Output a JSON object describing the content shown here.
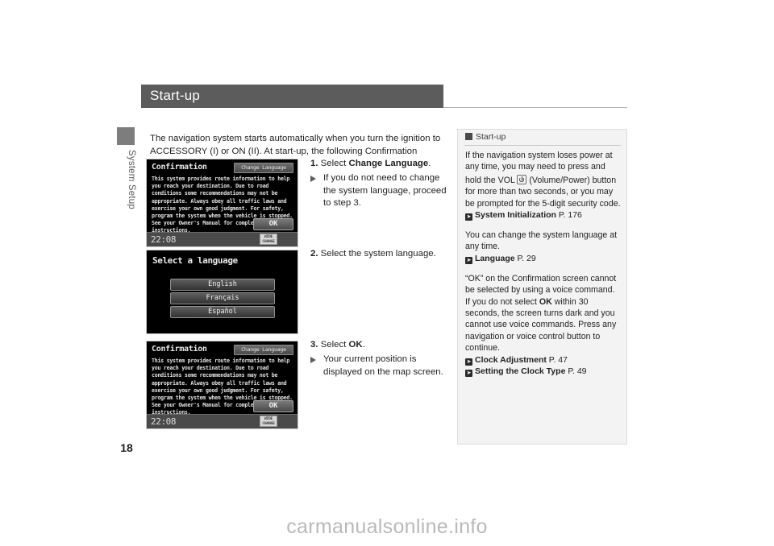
{
  "page": {
    "number": "18",
    "chapter_tab_label": "System Setup",
    "title": "Start-up",
    "watermark": "carmanualsonline.info",
    "accent_color": "#5c5c5c",
    "note_bg_color": "#f3f3f3",
    "chapter_tab_color": "#7d7d7d"
  },
  "intro": {
    "text": "The navigation system starts automatically when you turn the ignition to ACCESSORY (I) or ON (II). At start-up, the following Confirmation screen is displayed."
  },
  "steps": [
    {
      "number": "1.",
      "lead": "Select ",
      "bold": "Change Language",
      "tail": ".",
      "sub": "If you do not need to change the system language, proceed to step 3."
    },
    {
      "number": "2.",
      "lead": "Select the system language.",
      "bold": "",
      "tail": "",
      "sub": ""
    },
    {
      "number": "3.",
      "lead": "Select ",
      "bold": "OK",
      "tail": ".",
      "sub": "Your current position is displayed on the map screen."
    }
  ],
  "screens": {
    "confirmation": {
      "title": "Confirmation",
      "change_language_label": "Change Language",
      "body": "This system provides route information to help you reach your destination. Due to road conditions some recommendations may not be appropriate. Always obey all traffic laws and exercise your own good judgment. For safety, program the system when the vehicle is stopped. See your Owner's Manual for complete instructions.",
      "ok_label": "OK",
      "clock": "22:08",
      "badge_line1": "WIDE",
      "badge_line2": "CHANGE"
    },
    "language": {
      "title": "Select a language",
      "options": [
        "English",
        "Français",
        "Español"
      ]
    }
  },
  "note": {
    "header": "Start-up",
    "paragraphs": [
      {
        "text_before_icon": "If the navigation system loses power at any time, you may need to press and hold the VOL ",
        "icon": "power-icon",
        "text_after_icon": " (Volume/Power) button for more than two seconds, or you may be prompted for the 5-digit security code.",
        "refs": [
          {
            "name": "System Initialization",
            "page": "P. 176"
          }
        ]
      },
      {
        "text_before_icon": "You can change the system language at any time.",
        "icon": "",
        "text_after_icon": "",
        "refs": [
          {
            "name": "Language",
            "page": "P. 29"
          }
        ]
      },
      {
        "text_before_icon": "“OK” on the Confirmation screen cannot be selected by using a voice command. If you do not select ",
        "icon": "",
        "bold_inline": "OK",
        "text_after_icon": " within 30 seconds, the screen turns dark and you cannot use voice commands. Press any navigation or voice control button to continue.",
        "refs": [
          {
            "name": "Clock Adjustment",
            "page": "P. 47"
          },
          {
            "name": "Setting the Clock Type",
            "page": "P. 49"
          }
        ]
      }
    ]
  }
}
